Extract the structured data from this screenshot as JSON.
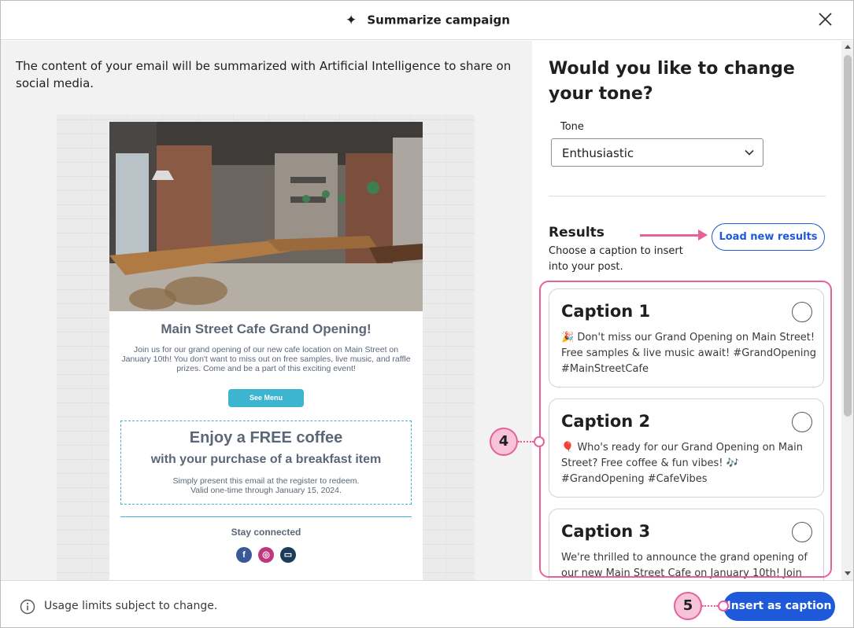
{
  "header": {
    "title": "Summarize campaign",
    "sparkle_icon": "sparkle-icon",
    "close_icon": "close-icon"
  },
  "left": {
    "intro": "The content of your email will be summarized with Artificial Intelligence to share on social media.",
    "email": {
      "title": "Main Street Cafe Grand Opening!",
      "body": "Join us for our grand opening of our new cafe location on Main Street on January 10th! You don't want to miss out on free samples, live music, and raffle prizes. Come and be a part of this exciting event!",
      "button": "See Menu",
      "coupon": {
        "headline": "Enjoy a FREE coffee",
        "subhead": "with your purchase of a breakfast item",
        "line1": "Simply present this email at the register to redeem.",
        "line2": "Valid one-time through January 15, 2024."
      },
      "stay_connected": "Stay connected",
      "socials": [
        {
          "name": "facebook-icon",
          "glyph": "f",
          "color": "#3b5998"
        },
        {
          "name": "instagram-icon",
          "glyph": "◎",
          "color": "#c1357f"
        },
        {
          "name": "website-icon",
          "glyph": "▭",
          "color": "#1d3c5a"
        }
      ]
    }
  },
  "right": {
    "question": "Would you like to change your tone?",
    "tone_label": "Tone",
    "tone_value": "Enthusiastic",
    "results_title": "Results",
    "results_sub": "Choose a caption to insert into your post.",
    "load_button": "Load new results",
    "captions": [
      {
        "title": "Caption 1",
        "text": "🎉 Don't miss our Grand Opening on Main Street! Free samples & live music await! #GrandOpening #MainStreetCafe"
      },
      {
        "title": "Caption 2",
        "text": "🎈 Who's ready for our Grand Opening on Main Street? Free coffee & fun vibes! 🎶 #GrandOpening #CafeVibes"
      },
      {
        "title": "Caption 3",
        "text": "We're thrilled to announce the grand opening of our new Main Street Cafe on January 10th! Join"
      }
    ]
  },
  "footer": {
    "usage": "Usage limits subject to change.",
    "insert_button": "Insert as caption"
  },
  "callouts": {
    "four": "4",
    "five": "5"
  },
  "colors": {
    "accent": "#1e59d9",
    "callout": "#e8609a",
    "email_accent": "#3db5d0"
  }
}
